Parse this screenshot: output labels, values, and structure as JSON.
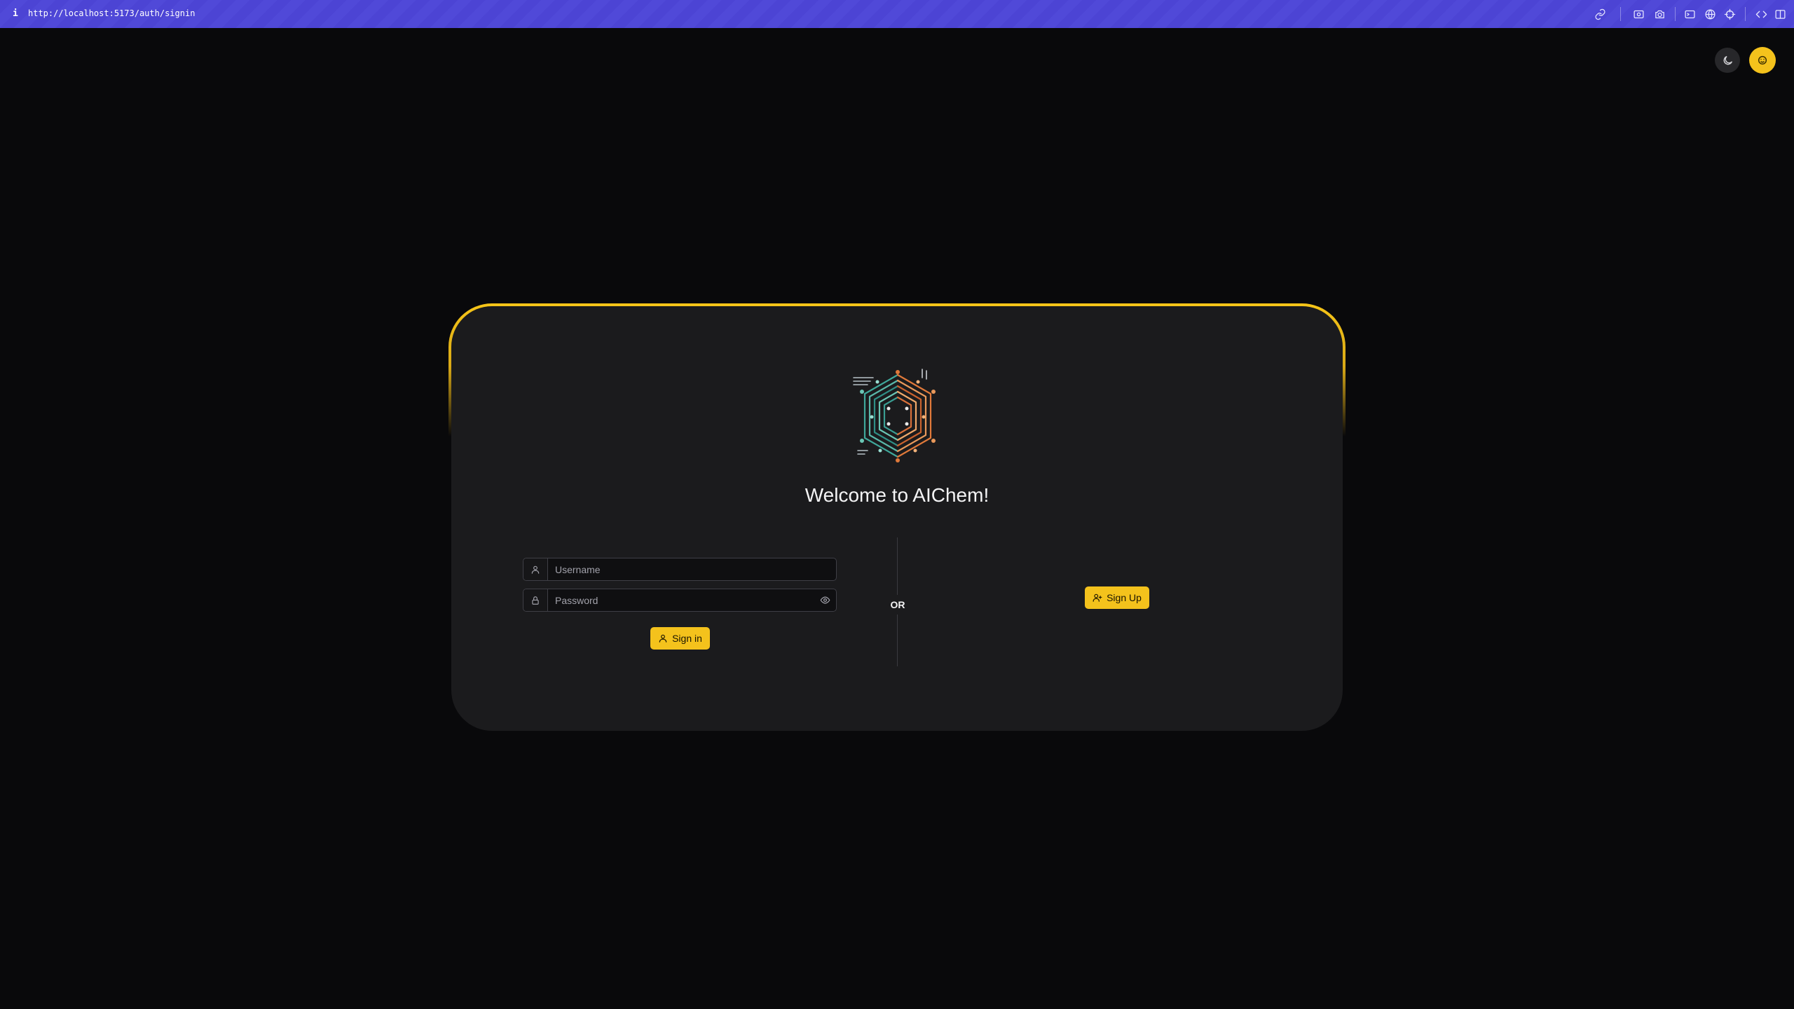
{
  "browser": {
    "info_label": "i",
    "url": "http://localhost:5173/auth/signin",
    "icons": [
      "link-icon",
      "screenshot-icon",
      "camera-icon",
      "terminal-icon",
      "globe-icon",
      "crosshair-icon",
      "devtools-icon",
      "split-panel-icon"
    ]
  },
  "header": {
    "theme_icon": "moon-icon",
    "user_icon": "user-avatar-icon"
  },
  "login": {
    "title": "Welcome to AIChem!",
    "username_placeholder": "Username",
    "password_placeholder": "Password",
    "signin_label": "Sign in",
    "or_label": "OR",
    "signup_label": "Sign Up"
  },
  "colors": {
    "accent": "#f4c21c",
    "background": "#09090b",
    "card": "#1b1b1d",
    "browser_bar": "#4c44d4"
  }
}
